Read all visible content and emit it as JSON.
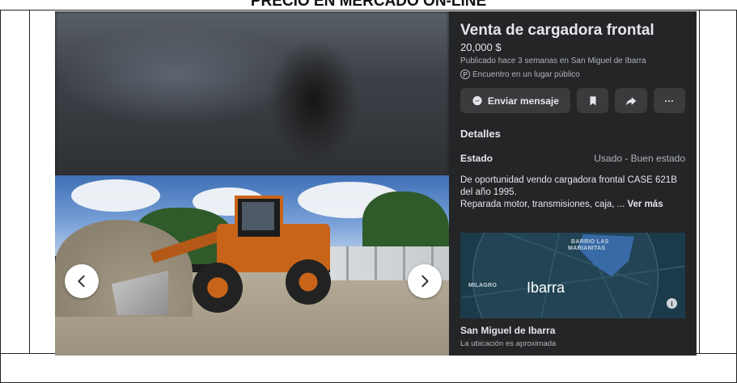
{
  "heading": "PRECIO EN MERCADO ON-LINE",
  "listing": {
    "title": "Venta de cargadora frontal",
    "price": "20,000 $",
    "published": "Publicado hace 3 semanas en San Miguel de Ibarra",
    "meetup": "Encuentro en un lugar público",
    "meetup_icon": "P"
  },
  "actions": {
    "message_label": "Enviar mensaje",
    "more_label": "···"
  },
  "details": {
    "section_title": "Detalles",
    "condition_label": "Estado",
    "condition_value": "Usado - Buen estado",
    "description_line1": "De oportunidad vendo cargadora frontal CASE 621B del año 1995.",
    "description_line2": "Reparada motor, transmisiones, caja, ... ",
    "see_more": "Ver más"
  },
  "map": {
    "label_district": "BARRIO LAS",
    "label_district2": "MARIANITAS",
    "label_west": "MILAGRO",
    "label_city": "Ibarra",
    "info_icon": "i"
  },
  "location": {
    "name": "San Miguel de Ibarra",
    "note": "La ubicación es aproximada"
  },
  "colors": {
    "panel_bg": "#242526",
    "button_bg": "#3a3b3c",
    "text_primary": "#e4e6eb",
    "text_secondary": "#b0b3b8"
  }
}
